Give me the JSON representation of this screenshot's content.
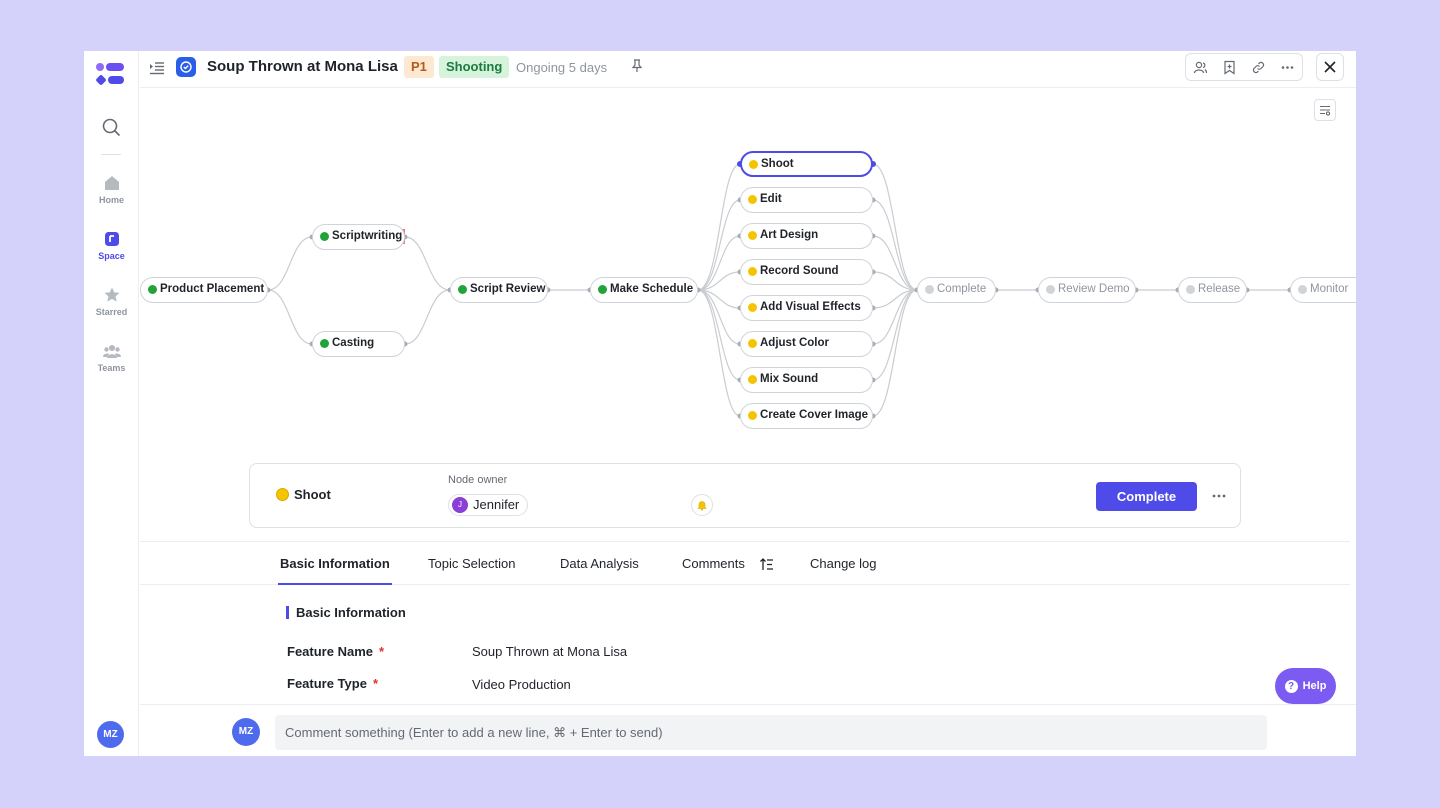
{
  "header": {
    "title": "Soup Thrown at Mona Lisa",
    "priority": "P1",
    "stage": "Shooting",
    "status": "Ongoing 5 days"
  },
  "sidebar": {
    "items": [
      {
        "label": "Home",
        "icon": "home-icon"
      },
      {
        "label": "Space",
        "icon": "space-icon",
        "active": true
      },
      {
        "label": "Starred",
        "icon": "star-icon"
      },
      {
        "label": "Teams",
        "icon": "teams-icon"
      }
    ],
    "user_initials": "MZ"
  },
  "flow": {
    "nodes": [
      {
        "id": "product",
        "label": "Product Placement",
        "status": "done"
      },
      {
        "id": "script",
        "label": "Scriptwriting",
        "status": "done"
      },
      {
        "id": "casting",
        "label": "Casting",
        "status": "done"
      },
      {
        "id": "review",
        "label": "Script Review",
        "status": "done"
      },
      {
        "id": "schedule",
        "label": "Make Schedule",
        "status": "done"
      },
      {
        "id": "shoot",
        "label": "Shoot",
        "status": "in-progress",
        "selected": true
      },
      {
        "id": "edit",
        "label": "Edit",
        "status": "in-progress"
      },
      {
        "id": "art",
        "label": "Art Design",
        "status": "in-progress"
      },
      {
        "id": "sound",
        "label": "Record Sound",
        "status": "in-progress"
      },
      {
        "id": "vfx",
        "label": "Add Visual Effects",
        "status": "in-progress"
      },
      {
        "id": "color",
        "label": "Adjust Color",
        "status": "in-progress"
      },
      {
        "id": "mix",
        "label": "Mix Sound",
        "status": "in-progress"
      },
      {
        "id": "cover",
        "label": "Create Cover Image",
        "status": "in-progress"
      },
      {
        "id": "complete",
        "label": "Complete",
        "status": "pending"
      },
      {
        "id": "demo",
        "label": "Review Demo",
        "status": "pending"
      },
      {
        "id": "release",
        "label": "Release",
        "status": "pending"
      },
      {
        "id": "monitor",
        "label": "Monitor",
        "status": "pending"
      }
    ]
  },
  "panel": {
    "node_name": "Shoot",
    "owner_label": "Node owner",
    "owner_name": "Jennifer",
    "owner_initial": "J",
    "complete_label": "Complete"
  },
  "tabs": [
    "Basic Information",
    "Topic Selection",
    "Data Analysis",
    "Comments",
    "Change log"
  ],
  "details": {
    "section_title": "Basic Information",
    "fields": [
      {
        "label": "Feature Name",
        "value": "Soup Thrown at Mona Lisa"
      },
      {
        "label": "Feature Type",
        "value": "Video Production"
      }
    ]
  },
  "help_label": "Help",
  "comment": {
    "placeholder": "Comment something (Enter to add a new line, ⌘ + Enter to send)",
    "user_initials": "MZ"
  },
  "colors": {
    "accent": "#4e4be8",
    "done": "#22a33a",
    "in_progress": "#f5c400",
    "pending": "#d0d3d8"
  }
}
